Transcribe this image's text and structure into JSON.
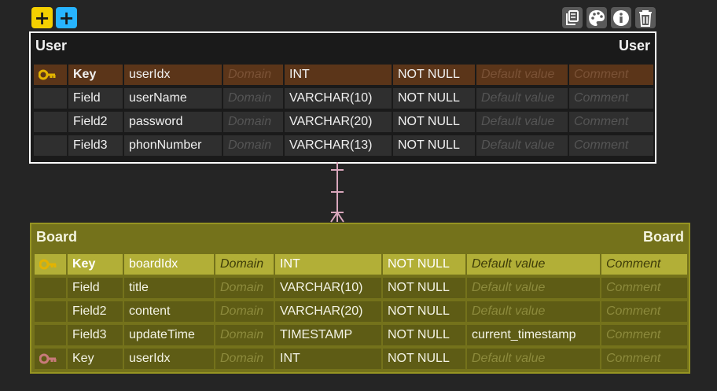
{
  "toolbar": {
    "add_yellow_label": "+",
    "add_blue_label": "+",
    "tools": [
      "copy-icon",
      "palette-icon",
      "info-icon",
      "trash-icon"
    ]
  },
  "colors": {
    "background": "#252525",
    "user_table_bg": "#1a1a1a",
    "user_pk_row": "#5b3519",
    "board_table_bg": "#74721b",
    "board_pk_row": "#b2af37",
    "relation_line": "#d9a7bc",
    "key_icon_primary": "#e3b300",
    "key_icon_foreign": "#c87a7a"
  },
  "tables": {
    "user": {
      "title_left": "User",
      "title_right": "User",
      "rows": [
        {
          "kind": "Key",
          "name": "userIdx",
          "domain": "Domain",
          "type": "INT",
          "null": "NOT NULL",
          "default": "Default value",
          "comment": "Comment",
          "key_icon": "primary-key-icon"
        },
        {
          "kind": "Field",
          "name": "userName",
          "domain": "Domain",
          "type": "VARCHAR(10)",
          "null": "NOT NULL",
          "default": "Default value",
          "comment": "Comment"
        },
        {
          "kind": "Field2",
          "name": "password",
          "domain": "Domain",
          "type": "VARCHAR(20)",
          "null": "NOT NULL",
          "default": "Default value",
          "comment": "Comment"
        },
        {
          "kind": "Field3",
          "name": "phonNumber",
          "domain": "Domain",
          "type": "VARCHAR(13)",
          "null": "NOT NULL",
          "default": "Default value",
          "comment": "Comment"
        }
      ]
    },
    "board": {
      "title_left": "Board",
      "title_right": "Board",
      "rows": [
        {
          "kind": "Key",
          "name": "boardIdx",
          "domain": "Domain",
          "type": "INT",
          "null": "NOT NULL",
          "default": "Default value",
          "comment": "Comment",
          "key_icon": "primary-key-icon"
        },
        {
          "kind": "Field",
          "name": "title",
          "domain": "Domain",
          "type": "VARCHAR(10)",
          "null": "NOT NULL",
          "default": "Default value",
          "comment": "Comment"
        },
        {
          "kind": "Field2",
          "name": "content",
          "domain": "Domain",
          "type": "VARCHAR(20)",
          "null": "NOT NULL",
          "default": "Default value",
          "comment": "Comment"
        },
        {
          "kind": "Field3",
          "name": "updateTime",
          "domain": "Domain",
          "type": "TIMESTAMP",
          "null": "NOT NULL",
          "default": "current_timestamp",
          "comment": "Comment"
        },
        {
          "kind": "Key",
          "name": "userIdx",
          "domain": "Domain",
          "type": "INT",
          "null": "NOT NULL",
          "default": "Default value",
          "comment": "Comment",
          "key_icon": "foreign-key-icon"
        }
      ]
    }
  }
}
